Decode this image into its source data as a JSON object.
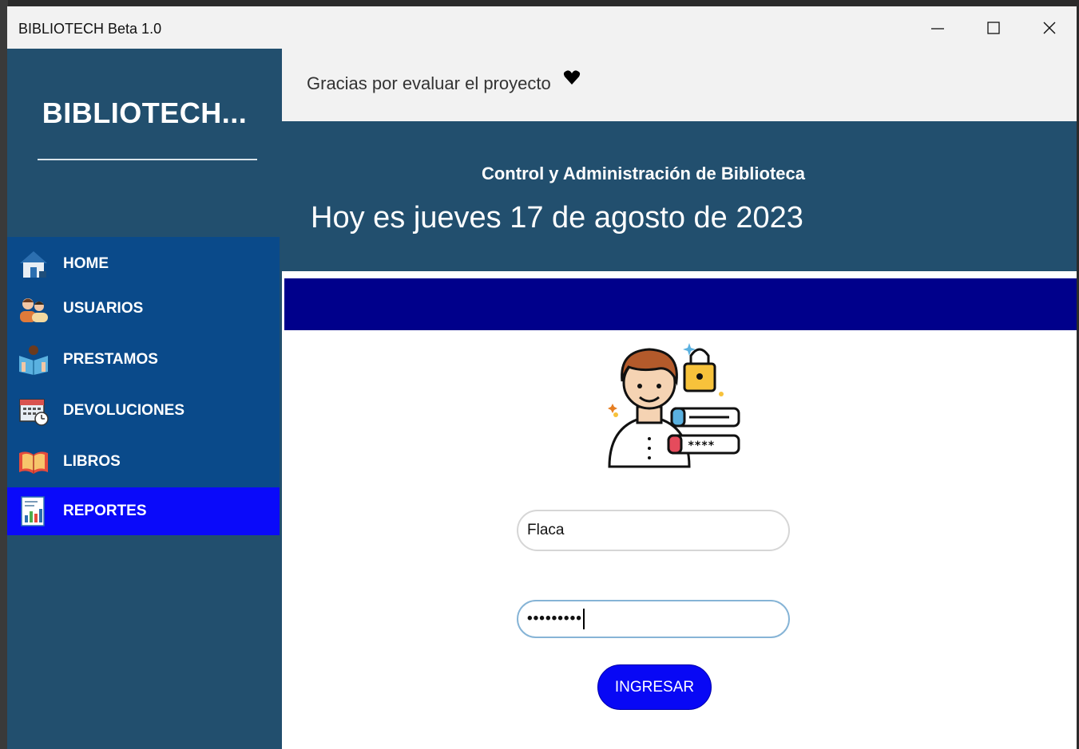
{
  "window": {
    "title": "BIBLIOTECH Beta 1.0",
    "controls": [
      "minimize-icon",
      "maximize-icon",
      "close-icon"
    ]
  },
  "sidebar": {
    "brand": "BIBLIOTECH...",
    "items": [
      {
        "label": "HOME",
        "icon": "home-icon",
        "active": false
      },
      {
        "label": "USUARIOS",
        "icon": "users-icon",
        "active": false
      },
      {
        "label": "PRESTAMOS",
        "icon": "reading-book-icon",
        "active": false
      },
      {
        "label": "DEVOLUCIONES",
        "icon": "calendar-clock-icon",
        "active": false
      },
      {
        "label": "LIBROS",
        "icon": "open-book-icon",
        "active": false
      },
      {
        "label": "REPORTES",
        "icon": "report-chart-icon",
        "active": true
      }
    ]
  },
  "topbar": {
    "message": "Gracias por evaluar el proyecto",
    "icon": "heart-icon"
  },
  "header": {
    "subtitle": "Control y Administración de Biblioteca",
    "date": "Hoy es jueves 17 de agosto de 2023"
  },
  "login": {
    "illustration": "user-login-lock-icon",
    "username_value": "Flaca",
    "password_masked": "•••••••••",
    "submit_label": "INGRESAR"
  },
  "colors": {
    "sidebar": "#224f6e",
    "menu": "#0a4a8a",
    "active_item": "#0a0afa",
    "band": "#00008b",
    "button": "#0808f5"
  }
}
